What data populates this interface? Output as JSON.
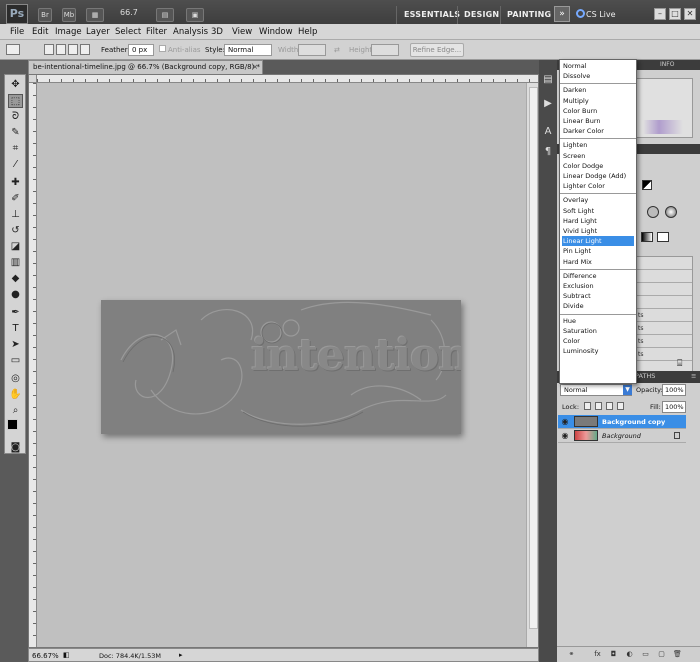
{
  "app": {
    "logo": "Ps",
    "bridge_btn": "Br",
    "minibridge_btn": "Mb",
    "zoom": "66.7",
    "workspaces": [
      "ESSENTIALS",
      "DESIGN",
      "PAINTING"
    ],
    "more_workspaces": "»",
    "cs_live": "CS Live",
    "window_min": "–",
    "window_max": "□",
    "window_close": "✕"
  },
  "menu": [
    "File",
    "Edit",
    "Image",
    "Layer",
    "Select",
    "Filter",
    "Analysis",
    "3D",
    "View",
    "Window",
    "Help"
  ],
  "options": {
    "feather_label": "Feather:",
    "feather_value": "0 px",
    "antialias_label": "Anti-alias",
    "style_label": "Style:",
    "style_value": "Normal",
    "width_label": "Width:",
    "height_label": "Height:",
    "refine_edge": "Refine Edge..."
  },
  "document": {
    "tab_title": "be-intentional-timeline.jpg @ 66.7% (Background copy, RGB/8) *",
    "tab_close": "×",
    "canvas_text": "intentional",
    "status_zoom": "66.67%",
    "status_doc": "Doc: 784.4K/1.53M"
  },
  "panels": {
    "info_tab": "INFO",
    "paths_tab": "PATHS",
    "rows": [
      "",
      "",
      "",
      "",
      "ts",
      "ts",
      "ts",
      "ts",
      ""
    ]
  },
  "layers": {
    "blend_mode": "Normal",
    "opacity_label": "Opacity:",
    "opacity_value": "100%",
    "lock_label": "Lock:",
    "fill_label": "Fill:",
    "fill_value": "100%",
    "items": [
      {
        "name": "Background copy",
        "selected": true
      },
      {
        "name": "Background",
        "selected": false
      }
    ]
  },
  "blend_dropdown": {
    "groups": [
      [
        "Normal",
        "Dissolve"
      ],
      [
        "Darken",
        "Multiply",
        "Color Burn",
        "Linear Burn",
        "Darker Color"
      ],
      [
        "Lighten",
        "Screen",
        "Color Dodge",
        "Linear Dodge (Add)",
        "Lighter Color"
      ],
      [
        "Overlay",
        "Soft Light",
        "Hard Light",
        "Vivid Light",
        "Linear Light",
        "Pin Light",
        "Hard Mix"
      ],
      [
        "Difference",
        "Exclusion",
        "Subtract",
        "Divide"
      ],
      [
        "Hue",
        "Saturation",
        "Color",
        "Luminosity"
      ]
    ],
    "highlighted": "Linear Light"
  },
  "colors": {
    "accent": "#3a8ee6",
    "foreground": "#000000",
    "background": "#ffffff"
  }
}
